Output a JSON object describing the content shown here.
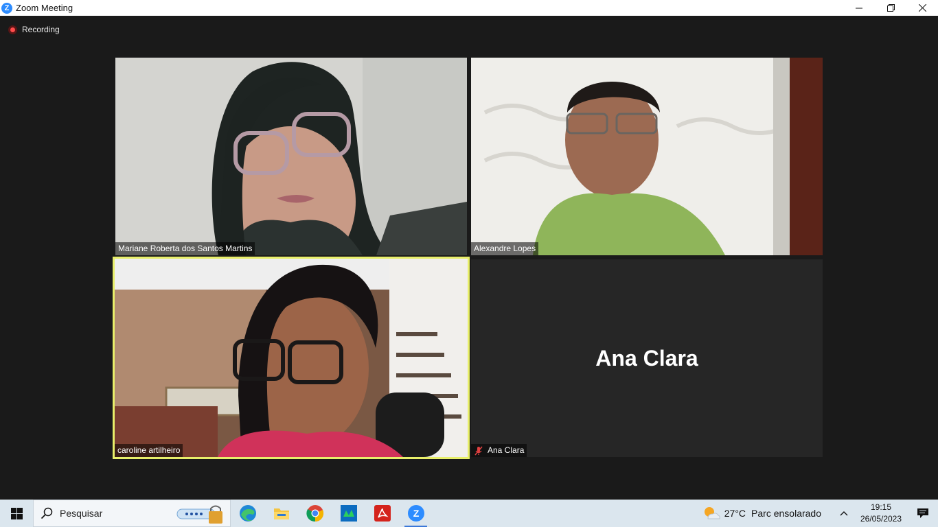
{
  "window": {
    "app_icon_letter": "Z",
    "title": "Zoom Meeting",
    "controls": [
      "minimize",
      "restore",
      "close"
    ]
  },
  "recording": {
    "label": "Recording"
  },
  "participants": [
    {
      "name": "Mariane Roberta dos Santos Martins",
      "video": true
    },
    {
      "name": "Alexandre Lopes",
      "video": true
    },
    {
      "name": "caroline artilheiro",
      "video": true,
      "active_speaker": true
    },
    {
      "name": "Ana Clara",
      "video": false,
      "muted": true,
      "display_name": "Ana Clara"
    }
  ],
  "colors": {
    "active_speaker_border": "#e8ef6a",
    "zoom_blue": "#2d8cff",
    "background": "#1a1a1a"
  },
  "taskbar": {
    "search_placeholder": "Pesquisar",
    "pinned_apps": [
      "edge-icon",
      "file-explorer-icon",
      "chrome-icon",
      "app-green-icon",
      "acrobat-icon",
      "zoom-icon"
    ],
    "active_app": "zoom-icon",
    "weather": {
      "temp": "27°C",
      "desc": "Parc ensolarado"
    },
    "clock": {
      "time": "19:15",
      "date": "26/05/2023"
    }
  }
}
